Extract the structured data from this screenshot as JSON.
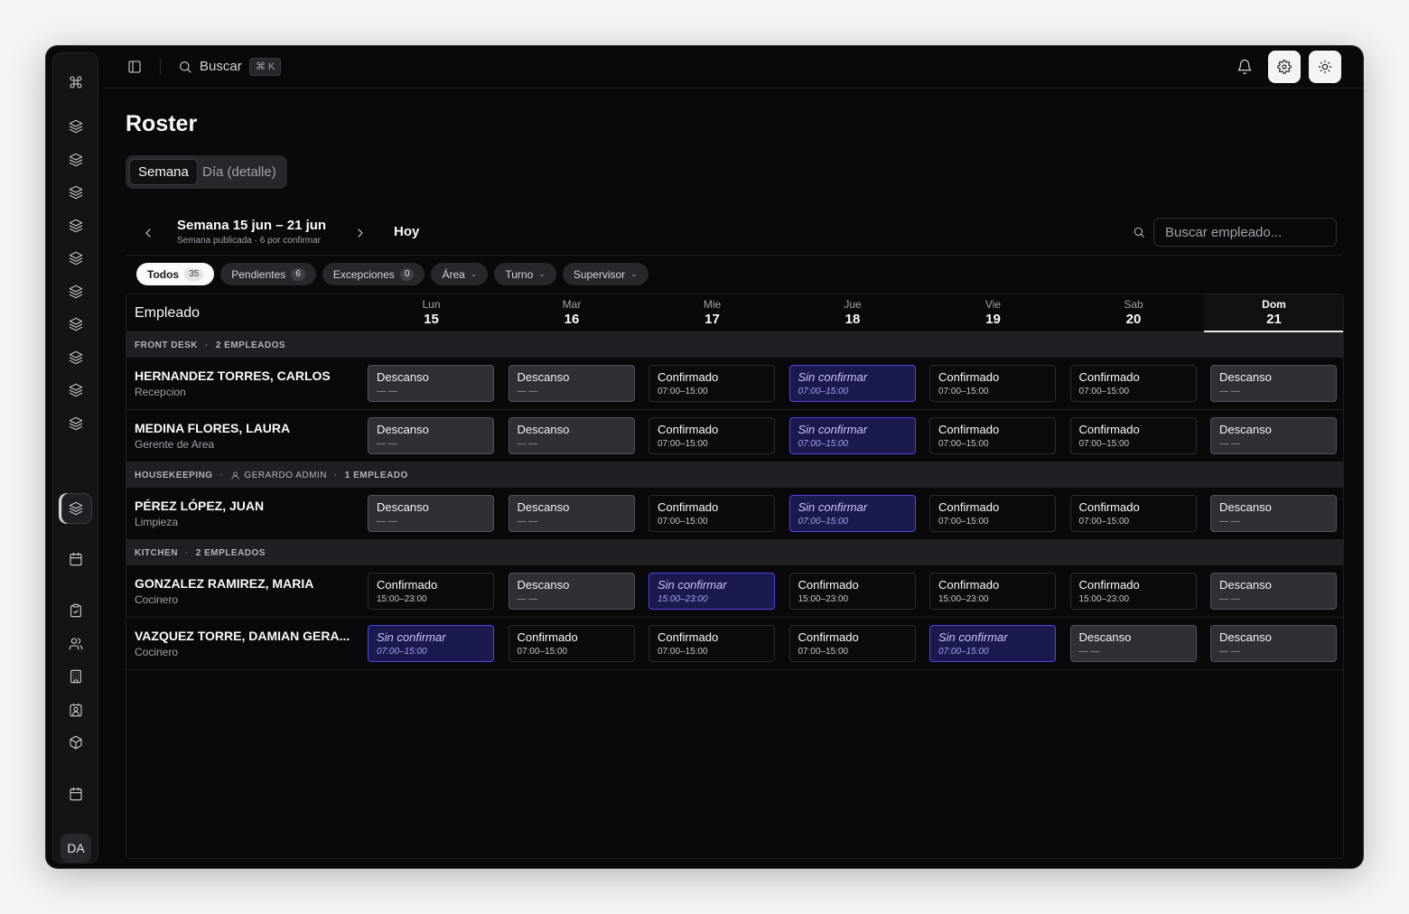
{
  "sidebar": {
    "logo_icon": "command-icon",
    "avatar": "DA",
    "icons": [
      "layers-icon",
      "layers-icon",
      "layers-icon",
      "layers-icon",
      "layers-icon",
      "layers-icon",
      "layers-icon",
      "layers-icon",
      "layers-icon",
      "layers-icon",
      "layers-icon",
      "calendar-icon",
      "clipboard-check-icon",
      "users-icon",
      "building-icon",
      "contact-icon",
      "box-icon",
      "calendar-icon",
      "users-icon"
    ]
  },
  "topbar": {
    "search_label": "Buscar",
    "shortcut": "⌘ K"
  },
  "page": {
    "title": "Roster",
    "view_tabs": [
      "Semana",
      "Día (detalle)"
    ],
    "week_title": "Semana 15 jun – 21 jun",
    "week_subtitle": "Semana publicada · 6 por confirmar",
    "today_label": "Hoy",
    "employee_search_placeholder": "Buscar empleado..."
  },
  "filters": [
    {
      "label": "Todos",
      "count": "35",
      "active": true
    },
    {
      "label": "Pendientes",
      "count": "6"
    },
    {
      "label": "Excepciones",
      "count": "0"
    },
    {
      "label": "Área",
      "dropdown": true
    },
    {
      "label": "Turno",
      "dropdown": true
    },
    {
      "label": "Supervisor",
      "dropdown": true
    }
  ],
  "table": {
    "employee_header": "Empleado",
    "days": [
      {
        "name": "Lun",
        "date": "15"
      },
      {
        "name": "Mar",
        "date": "16"
      },
      {
        "name": "Mie",
        "date": "17"
      },
      {
        "name": "Jue",
        "date": "18"
      },
      {
        "name": "Vie",
        "date": "19"
      },
      {
        "name": "Sab",
        "date": "20"
      },
      {
        "name": "Dom",
        "date": "21",
        "today": true
      }
    ],
    "groups": [
      {
        "name": "FRONT DESK",
        "supervisor": "",
        "count_label": "2 EMPLEADOS",
        "employees": [
          {
            "name": "HERNANDEZ TORRES, CARLOS",
            "role": "Recepcion",
            "shifts": [
              [
                "Descanso",
                "— —"
              ],
              [
                "Descanso",
                "— —"
              ],
              [
                "Confirmado",
                "07:00–15:00"
              ],
              [
                "Sin confirmar",
                "07:00–15:00"
              ],
              [
                "Confirmado",
                "07:00–15:00"
              ],
              [
                "Confirmado",
                "07:00–15:00"
              ],
              [
                "Descanso",
                "— —"
              ]
            ]
          },
          {
            "name": "MEDINA FLORES, LAURA",
            "role": "Gerente de Area",
            "shifts": [
              [
                "Descanso",
                "— —"
              ],
              [
                "Descanso",
                "— —"
              ],
              [
                "Confirmado",
                "07:00–15:00"
              ],
              [
                "Sin confirmar",
                "07:00–15:00"
              ],
              [
                "Confirmado",
                "07:00–15:00"
              ],
              [
                "Confirmado",
                "07:00–15:00"
              ],
              [
                "Descanso",
                "— —"
              ]
            ]
          }
        ]
      },
      {
        "name": "HOUSEKEEPING",
        "supervisor": "GERARDO ADMIN",
        "count_label": "1 EMPLEADO",
        "employees": [
          {
            "name": "PÉREZ LÓPEZ, JUAN",
            "role": "Limpieza",
            "shifts": [
              [
                "Descanso",
                "— —"
              ],
              [
                "Descanso",
                "— —"
              ],
              [
                "Confirmado",
                "07:00–15:00"
              ],
              [
                "Sin confirmar",
                "07:00–15:00"
              ],
              [
                "Confirmado",
                "07:00–15:00"
              ],
              [
                "Confirmado",
                "07:00–15:00"
              ],
              [
                "Descanso",
                "— —"
              ]
            ]
          }
        ]
      },
      {
        "name": "KITCHEN",
        "supervisor": "",
        "count_label": "2 EMPLEADOS",
        "employees": [
          {
            "name": "GONZALEZ RAMIREZ, MARIA",
            "role": "Cocinero",
            "shifts": [
              [
                "Confirmado",
                "15:00–23:00"
              ],
              [
                "Descanso",
                "— —"
              ],
              [
                "Sin confirmar",
                "15:00–23:00"
              ],
              [
                "Confirmado",
                "15:00–23:00"
              ],
              [
                "Confirmado",
                "15:00–23:00"
              ],
              [
                "Confirmado",
                "15:00–23:00"
              ],
              [
                "Descanso",
                "— —"
              ]
            ]
          },
          {
            "name": "VAZQUEZ TORRE, DAMIAN GERA...",
            "role": "Cocinero",
            "shifts": [
              [
                "Sin confirmar",
                "07:00–15:00"
              ],
              [
                "Confirmado",
                "07:00–15:00"
              ],
              [
                "Confirmado",
                "07:00–15:00"
              ],
              [
                "Confirmado",
                "07:00–15:00"
              ],
              [
                "Sin confirmar",
                "07:00–15:00"
              ],
              [
                "Descanso",
                "— —"
              ],
              [
                "Descanso",
                "— —"
              ]
            ]
          }
        ]
      }
    ]
  }
}
